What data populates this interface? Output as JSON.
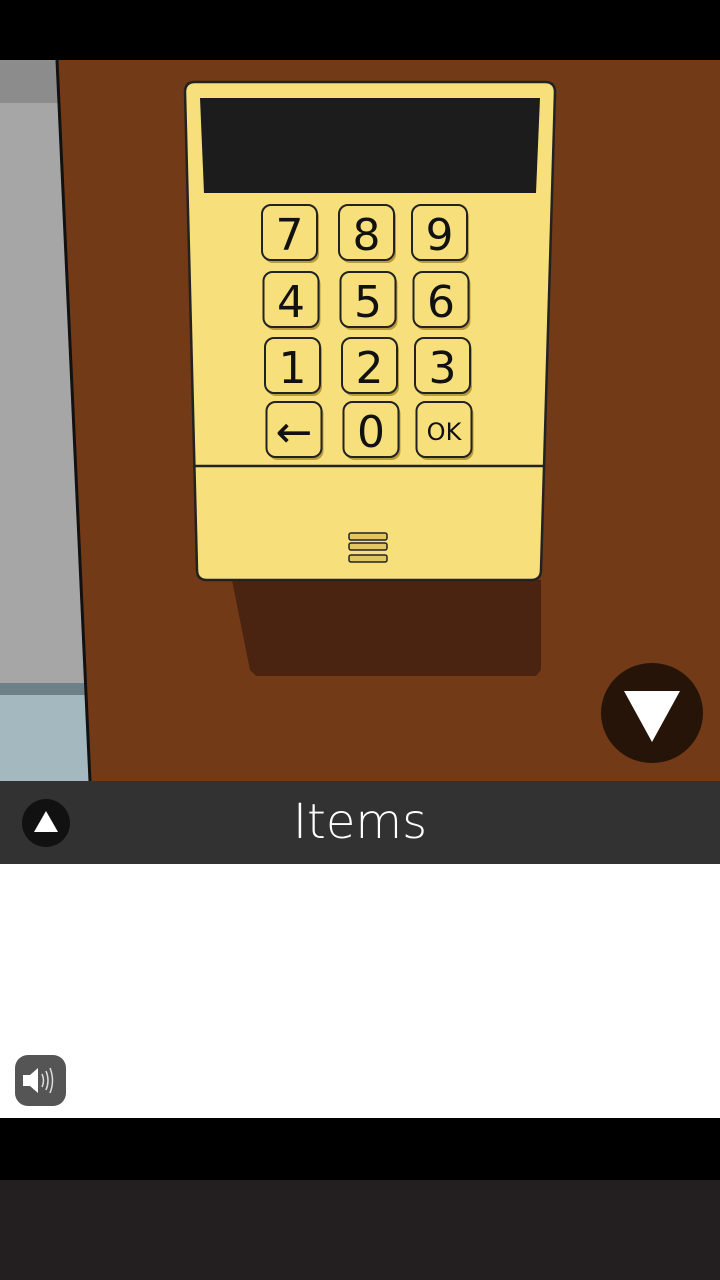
{
  "scene": {
    "keypad": {
      "keys": [
        {
          "label": "7"
        },
        {
          "label": "8"
        },
        {
          "label": "9"
        },
        {
          "label": "4"
        },
        {
          "label": "5"
        },
        {
          "label": "6"
        },
        {
          "label": "1"
        },
        {
          "label": "2"
        },
        {
          "label": "3"
        },
        {
          "label": "←"
        },
        {
          "label": "0"
        },
        {
          "label": "OK"
        }
      ],
      "display_value": ""
    },
    "nav_down_icon": "triangle-down-icon"
  },
  "items_bar": {
    "title": "Items",
    "toggle_icon": "triangle-up-icon"
  },
  "sound": {
    "icon": "speaker-icon"
  },
  "colors": {
    "wall": "#733a17",
    "keypad": "#f7e07b",
    "bar": "#323232"
  }
}
